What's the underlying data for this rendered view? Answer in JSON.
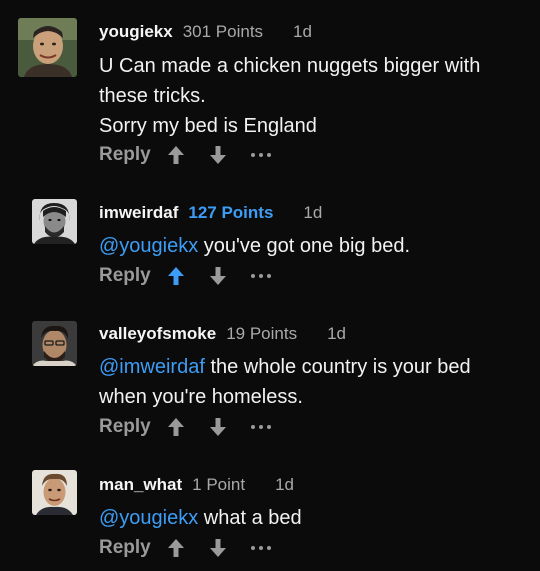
{
  "colors": {
    "background": "#0b0b0b",
    "text": "#f2f2f2",
    "muted": "#a9a9a9",
    "accent": "#3d9df6"
  },
  "comments": [
    {
      "username": "yougiekx",
      "points": "301 Points",
      "time": "1d",
      "upvoted": false,
      "lines": [
        {
          "mention": "",
          "text": "U Can made a chicken nuggets bigger with these tricks."
        },
        {
          "mention": "",
          "text": "Sorry my bed is England"
        }
      ],
      "reply_label": "Reply"
    },
    {
      "username": "imweirdaf",
      "points": "127 Points",
      "time": "1d",
      "upvoted": true,
      "lines": [
        {
          "mention": "@yougiekx",
          "text": " you've got one big bed."
        }
      ],
      "reply_label": "Reply"
    },
    {
      "username": "valleyofsmoke",
      "points": "19 Points",
      "time": "1d",
      "upvoted": false,
      "lines": [
        {
          "mention": "@imweirdaf",
          "text": " the whole country is your bed when you're homeless."
        }
      ],
      "reply_label": "Reply"
    },
    {
      "username": "man_what",
      "points": "1 Point",
      "time": "1d",
      "upvoted": false,
      "lines": [
        {
          "mention": "@yougiekx",
          "text": " what a bed"
        }
      ],
      "reply_label": "Reply"
    }
  ],
  "icons": {
    "upvote": "arrow-up-icon",
    "downvote": "arrow-down-icon",
    "more": "more-options-icon"
  }
}
